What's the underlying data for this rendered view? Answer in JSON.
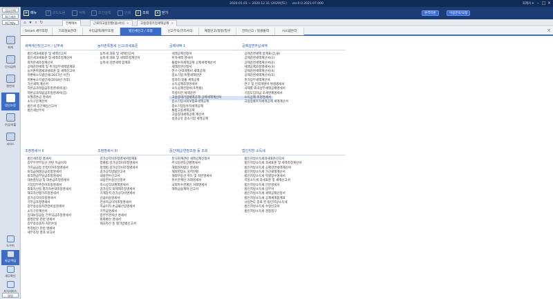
{
  "titlebar": {
    "segments": [
      "2020.01.01 ~ 2020.12.31 (2020년도)",
      "ver.0.0.2021.07.000"
    ],
    "account": "회계사 ▾"
  },
  "toolbar": {
    "menu": "메뉴",
    "items": [
      "코드도움",
      "삭제",
      "조건검색",
      "인쇄",
      "조회",
      "닫기"
    ],
    "pills": [
      "원격지원",
      "이용문의/요청"
    ]
  },
  "sidebar": {
    "top_buttons": [
      "업무선택",
      "최근세션",
      "최근메뉴"
    ],
    "items": [
      "회계",
      "인사급여",
      "원천세",
      "법인조정",
      "수입/지출",
      "서비스"
    ],
    "bottom_items": [
      "도우미",
      "마감/백업",
      "세무확인",
      "지식서비스",
      "알림"
    ]
  },
  "doctabs": [
    {
      "label": "전체메뉴"
    },
    {
      "label": "근로자고용현황(을)서식"
    },
    {
      "label": "고용증대기업세액공제"
    }
  ],
  "menutabs": [
    "Smart 세무조정",
    "기초정보관리",
    "수입금액/재무조정",
    "법인세신고 / 조정",
    "신고부속/기타서식",
    "예정신고/정정/청구",
    "전자신고 / 일괄출력",
    "시스템관리"
  ],
  "sections": [
    {
      "title": "세액계산및신고서 / 납부세",
      "items": [
        "법인세과세표준 및 세액신고서",
        "법인세과세표준 및 세액조정계산서",
        "최저한세조정계산서",
        "공제감면세액 및 추가납부세액합계표",
        "농어촌특별세과세표준 및 세액신고서",
        "미환류소득법인세(2017년 이전)",
        "미환류소득법인세(2018년 이후)",
        "가산세액 계산서",
        "자본금과적립금조정명세서(을)",
        "자본금과적립금조정명세서(갑)",
        "이월결손금 명세서",
        "소득구분계산서",
        "법인세 중간예납신고서",
        "법인세납부서"
      ]
    },
    {
      "title": "농어촌특별세 신고/과세표준",
      "items": [
        "농특세 과표 및 세액신고서",
        "농특세 과표 및 세액조정계산서",
        "농특세 감면세액 합계표"
      ]
    },
    {
      "title": "공제세액 1",
      "items": [
        "세액공제신청서",
        "투자세액 명세서",
        "통합투자세액공제 공제세액계산서",
        "세액감면신청서",
        "연구·인력개발비 세액공제",
        "중소기업 특별세액감면",
        "일자리 창출 세액공제",
        "소득공제조정명세서",
        "소득공제신청서(조특법)",
        "지방이전 세액감면",
        "고용증대기업세액공제 공제세액계산서",
        "중소기업사회보험료세액공제",
        "중소기업등투자세액공제",
        "통합고용세액공제",
        "고용증대세액공제 계산서",
        "성과공유 중소기업 세액공제"
      ],
      "highlight": 10
    },
    {
      "title": "공제감면추납세액",
      "items": [
        "공제감면세액 합계표(갑,을)",
        "공제감면세액계산서(1)",
        "공제감면세액계산서(2)",
        "세액공제조정명세서(3)",
        "공제감면세액계산서(4)",
        "공제감면세액계산서(5)",
        "추가납부세액계산서",
        "연구 및 인력개발비 발생명세서",
        "국제를 외국납부세액공제명세서",
        "기업도입자금 조세면제명세서",
        "소득공제 조정명세서",
        "고용창출투자세액공제 세액계산서"
      ]
    },
    {
      "title": "조정명세서 II",
      "items": [
        "법인세조정 명세서",
        "업무무관부동산 관련 지급이자",
        "가지급금등 인정이자조정명세서",
        "퇴직급여충당금조정명세서",
        "퇴직연금부담금조정명세서",
        "대손충당금 및 대손금조정명세서",
        "기업업무추진비조정명세서",
        "외화자산등 평가차손익조정명세서",
        "재고자산평가조정명세서",
        "감가상각비조정명세서",
        "기부금조정명세서",
        "업무용승용차관련비용명세서",
        "소득구분계산서",
        "임대보증금등 간주익금조정명세서",
        "합병분할 관련 명세서",
        "업무용승용차 처분손실",
        "특정법인 관련 명세서",
        "세무조정 결과 보고서"
      ]
    },
    {
      "title": "조정명세서 III",
      "items": [
        "감가상각비조정명세서합계표",
        "정률법 감가상각비조정명세서",
        "정액법 감가상각비조정명세서",
        "감가상각방법신고서",
        "내용연수신고서",
        "내용연수승인신청서",
        "즉시상각의제액명세서",
        "감가상각 의제액조정명세서",
        "기계장치 감가상각비명세서",
        "선급비용명세서",
        "건설자금이자조정명세서",
        "지급이자 손금불산입명세서",
        "기부금명세서",
        "업무무관자산 명세서",
        "외화환산 명세서",
        "재고자산 등 평가방법신고서"
      ]
    },
    {
      "title": "중간예납/연말조정 등 조회",
      "items": [
        "분식회계관련 세액공제신청서",
        "주식등변동상황명세서",
        "해외현지법인 명세서",
        "해외영업소 설치현황",
        "해외부동산 취득 및 처분명세서",
        "특수관계인 거래명세서",
        "국외특수관계인 거래명세서",
        "해외금융계좌 신고서"
      ]
    },
    {
      "title": "법인지방 소득세",
      "items": [
        "법인지방소득세과세표준신고서",
        "법인지방소득세 과세표준 및 세액조정계산서",
        "법인지방소득세 공제감면세액계산서",
        "법인지방소득세 가산세액계산서",
        "법인지방소득세 특별징수명세서",
        "지방소득세 과세표준 및 세액신고서",
        "법인지방소득세 안분명세서",
        "법인지방소득세 납부서",
        "법인지방소득세 세액공제신청서",
        "법인지방소득세 공제세액합계표",
        "사업연도 종료 전 법인지방소득세",
        "법인지방소득세 수정신고서",
        "법인지방소득세 경정청구"
      ]
    }
  ]
}
